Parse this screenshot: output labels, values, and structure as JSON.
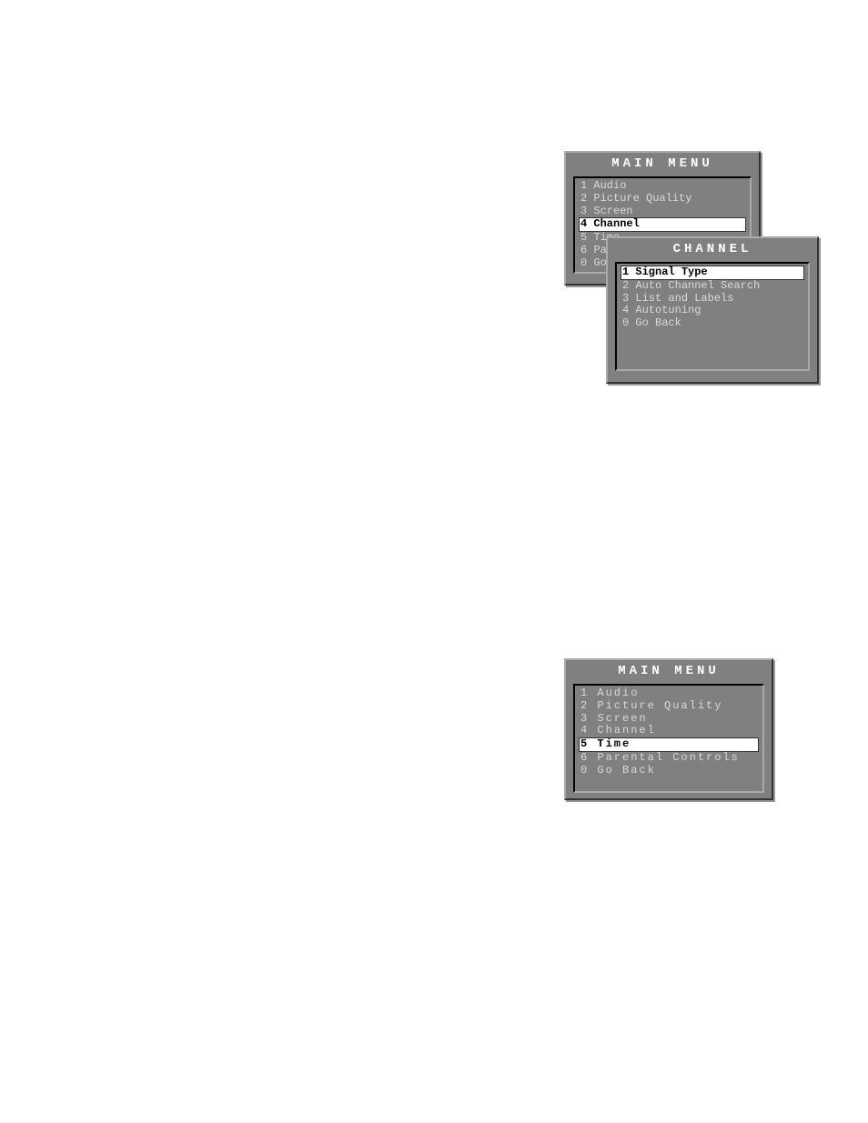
{
  "panel1": {
    "title": "MAIN MENU",
    "items": [
      {
        "num": "1",
        "label": "Audio",
        "selected": false
      },
      {
        "num": "2",
        "label": "Picture Quality",
        "selected": false
      },
      {
        "num": "3",
        "label": "Screen",
        "selected": false
      },
      {
        "num": "4",
        "label": "Channel",
        "selected": true
      },
      {
        "num": "5",
        "label": "Time",
        "selected": false
      },
      {
        "num": "6",
        "label": "Par",
        "selected": false
      },
      {
        "num": "0",
        "label": "Go",
        "selected": false
      }
    ]
  },
  "panel2": {
    "title": "CHANNEL",
    "items": [
      {
        "num": "1",
        "label": "Signal Type",
        "selected": true
      },
      {
        "num": "2",
        "label": "Auto Channel Search",
        "selected": false
      },
      {
        "num": "3",
        "label": "List and Labels",
        "selected": false
      },
      {
        "num": "4",
        "label": "Autotuning",
        "selected": false
      },
      {
        "num": "0",
        "label": "Go Back",
        "selected": false
      }
    ]
  },
  "panel3": {
    "title": "MAIN MENU",
    "items": [
      {
        "num": "1",
        "label": "Audio",
        "selected": false
      },
      {
        "num": "2",
        "label": "Picture Quality",
        "selected": false
      },
      {
        "num": "3",
        "label": "Screen",
        "selected": false
      },
      {
        "num": "4",
        "label": "Channel",
        "selected": false
      },
      {
        "num": "5",
        "label": "Time",
        "selected": true
      },
      {
        "num": "6",
        "label": "Parental Controls",
        "selected": false
      },
      {
        "num": "0",
        "label": "Go Back",
        "selected": false
      }
    ]
  }
}
